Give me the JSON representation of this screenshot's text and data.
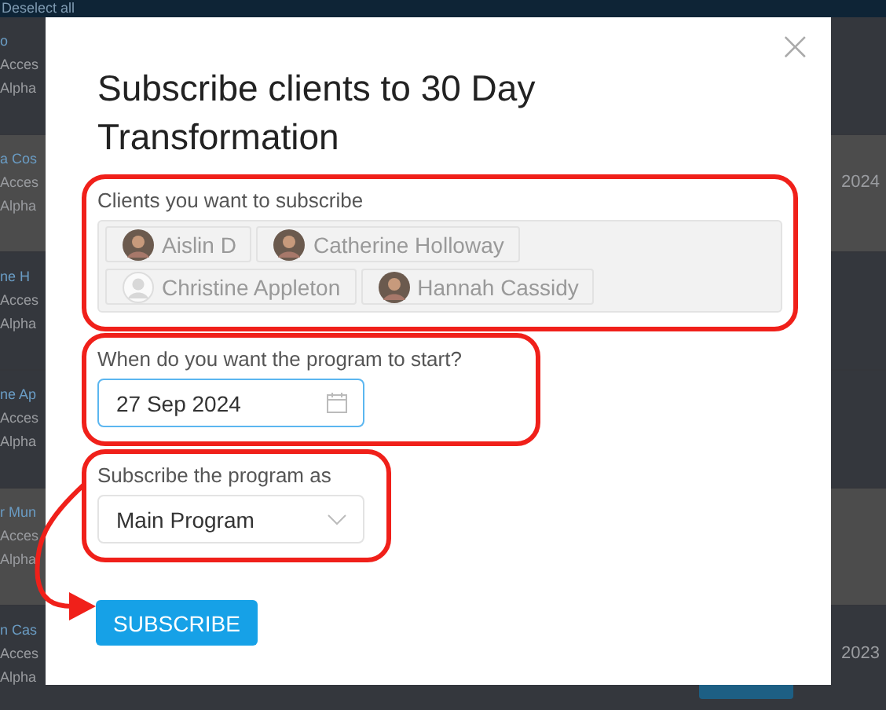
{
  "background": {
    "toolbar": {
      "label": "Deselect all"
    },
    "rows": [
      {
        "name": "o",
        "line_2": "Acces",
        "line_3": "Alpha",
        "selected": false
      },
      {
        "name": "a Cos",
        "line_2": "Acces",
        "line_3": "Alpha",
        "date": "2024",
        "selected": true
      },
      {
        "name": "ne H",
        "line_2": "Acces",
        "line_3": "Alpha",
        "selected": false
      },
      {
        "name": "ne Ap",
        "line_2": "Acces",
        "line_3": "Alpha",
        "selected": false
      },
      {
        "name": "r Mun",
        "line_2": "Acces",
        "line_3": "Alpha",
        "selected": true
      },
      {
        "name": "n Cas",
        "line_2": "Acces",
        "line_3": "Alpha",
        "date": "2023",
        "selected": false
      }
    ]
  },
  "dialog": {
    "title": "Subscribe clients to 30 Day Transformation",
    "close": "×",
    "clients": {
      "label": "Clients you want to subscribe",
      "chips": [
        {
          "name": "Aislin D",
          "kind": "photo"
        },
        {
          "name": "Catherine Holloway",
          "kind": "photo"
        },
        {
          "name": "Christine Appleton",
          "kind": "default"
        },
        {
          "name": "Hannah Cassidy",
          "kind": "photo"
        }
      ]
    },
    "start": {
      "label": "When do you want the program to start?",
      "value": "27 Sep 2024"
    },
    "subscribe_as": {
      "label": "Subscribe the program as",
      "value": "Main Program"
    },
    "button": "SUBSCRIBE"
  }
}
